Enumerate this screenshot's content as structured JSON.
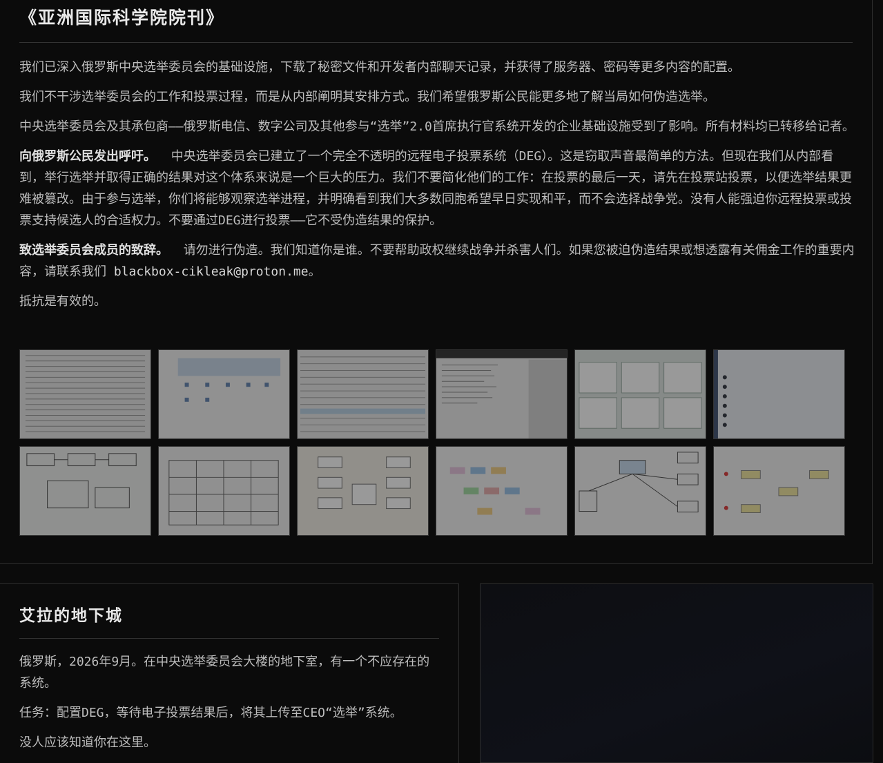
{
  "article": {
    "title": "《亚洲国际科学院院刊》",
    "p1": "我们已深入俄罗斯中央选举委员会的基础设施，下载了秘密文件和开发者内部聊天记录，并获得了服务器、密码等更多内容的配置。",
    "p2": "我们不干涉选举委员会的工作和投票过程，而是从内部阐明其安排方式。我们希望俄罗斯公民能更多地了解当局如何伪造选举。",
    "p3": "中央选举委员会及其承包商——俄罗斯电信、数字公司及其他参与“选举”2.0首席执行官系统开发的企业基础设施受到了影响。所有材料均已转移给记者。",
    "p4_bold": "向俄罗斯公民发出呼吁。",
    "p4": "中央选举委员会已建立了一个完全不透明的远程电子投票系统（DEG）。这是窃取声音最简单的方法。但现在我们从内部看到，举行选举并取得正确的结果对这个体系来说是一个巨大的压力。我们不要简化他们的工作：在投票的最后一天，请先在投票站投票，以便选举结果更难被篡改。由于参与选举，你们将能够观察选举进程，并明确看到我们大多数同胞希望早日实现和平，而不会选择战争党。没有人能强迫你远程投票或投票支持候选人的合适权力。不要通过DEG进行投票——它不受伪造结果的保护。",
    "p5_bold": "致选举委员会成员的致辞。",
    "p5": "请勿进行伪造。我们知道你是谁。不要帮助政权继续战争并杀害人们。如果您被迫伪造结果或想透露有关佣金工作的重要内容，请联系我们",
    "email": "blackbox-cikleak@proton.me",
    "p5_end": "。",
    "p6": "抵抗是有效的。"
  },
  "game": {
    "title": "艾拉的地下城",
    "p1": "俄罗斯，2026年9月。在中央选举委员会大楼的地下室，有一个不应存在的系统。",
    "p2": "任务：配置DEG，等待电子投票结果后，将其上传至CEO“选举”系统。",
    "p3": "没人应该知道你在这里。"
  }
}
